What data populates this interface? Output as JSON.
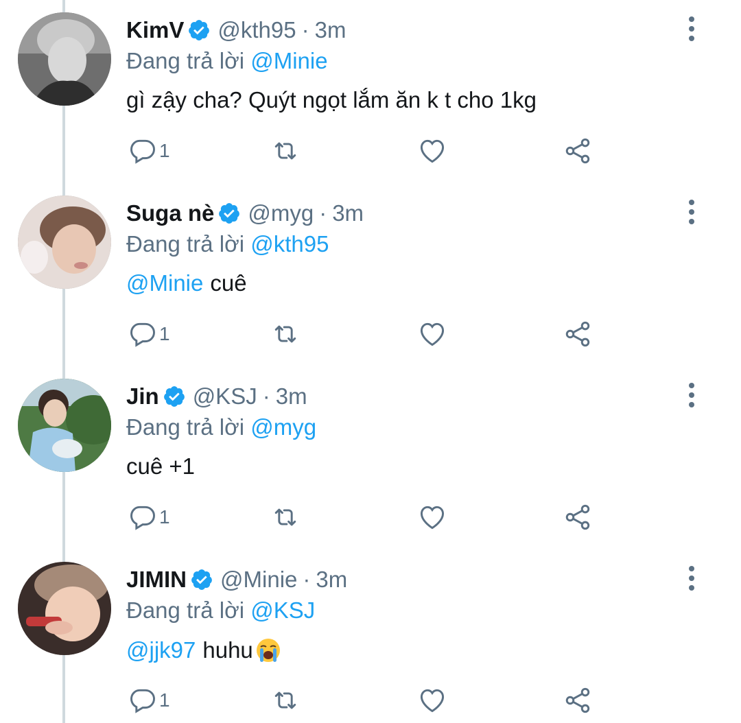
{
  "tweets": [
    {
      "display_name": "KimV",
      "handle": "@kth95",
      "dot": "·",
      "time": "3m",
      "reply_prefix": "Đang trả lời",
      "reply_to": "@Minie",
      "body_mention": "",
      "body_text": "gì zậy cha? Quýt ngọt lắm ăn k t cho 1kg",
      "reply_count": "1",
      "avatar": "avatar-kimv"
    },
    {
      "display_name": "Suga nè",
      "handle": "@myg",
      "dot": "·",
      "time": "3m",
      "reply_prefix": "Đang trả lời",
      "reply_to": "@kth95",
      "body_mention": "@Minie",
      "body_text": "cuê",
      "reply_count": "1",
      "avatar": "avatar-suga"
    },
    {
      "display_name": "Jin",
      "handle": "@KSJ",
      "dot": "·",
      "time": "3m",
      "reply_prefix": "Đang trả lời",
      "reply_to": "@myg",
      "body_mention": "",
      "body_text": "cuê +1",
      "reply_count": "1",
      "avatar": "avatar-jin"
    },
    {
      "display_name": "JIMIN",
      "handle": "@Minie",
      "dot": "·",
      "time": "3m",
      "reply_prefix": "Đang trả lời",
      "reply_to": "@KSJ",
      "body_mention": "@jjk97",
      "body_text": "huhu",
      "body_emoji": "loudly-crying-face",
      "reply_count": "1",
      "avatar": "avatar-jimin"
    }
  ],
  "colors": {
    "accent": "#1da1f2",
    "text": "#14171a",
    "muted": "#5b7083",
    "thread_line": "#cfd9de"
  },
  "icons": {
    "verified": "verified-badge-icon",
    "more": "more-vertical-icon",
    "reply": "reply-icon",
    "retweet": "retweet-icon",
    "like": "heart-icon",
    "share": "share-icon"
  }
}
